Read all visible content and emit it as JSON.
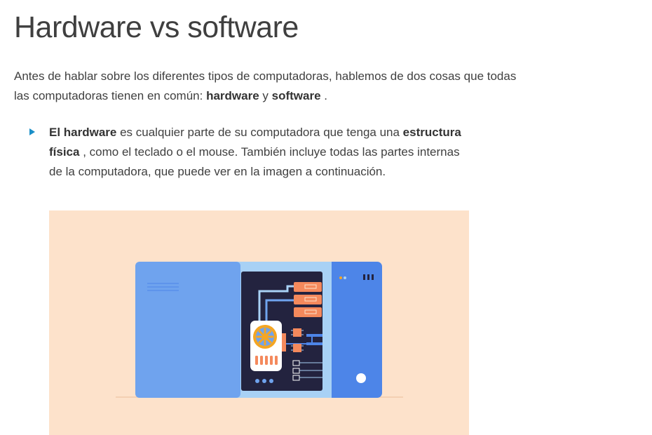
{
  "heading": "Hardware vs software",
  "intro": {
    "text_before": "Antes de hablar sobre los diferentes tipos de computadoras, hablemos de dos cosas que todas las computadoras tienen en común: ",
    "term_hardware": "hardware",
    "connector": " y ",
    "term_software": "software",
    "text_after": " ."
  },
  "bullet": {
    "lead_bold": "El hardware",
    "text_1": " es cualquier parte de su computadora que tenga una ",
    "bold_2": "estructura física",
    "text_2": " , como el teclado o el mouse. También incluye todas las partes internas de la computadora, que puede ver en la imagen a continuación."
  },
  "illustration": {
    "icon": "computer-case-hardware-illustration",
    "colors": {
      "background": "#fde2cb",
      "side_panel": "#6fa3ee",
      "case_body": "#4d85e8",
      "frame": "#a8d1f5",
      "board": "#23233f",
      "ram": "#f4895c",
      "fan": "#f5a623"
    }
  }
}
